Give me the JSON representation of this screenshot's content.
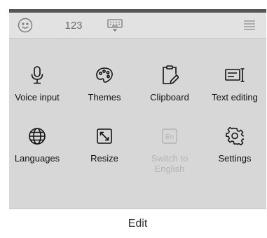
{
  "toolbar": {
    "emoji_icon": "emoji-icon",
    "number_label": "123",
    "keyboard_icon": "keyboard-hide-icon",
    "menu_icon": "menu-icon"
  },
  "options": [
    {
      "label": "Voice input",
      "icon": "microphone-icon",
      "enabled": true
    },
    {
      "label": "Themes",
      "icon": "palette-icon",
      "enabled": true
    },
    {
      "label": "Clipboard",
      "icon": "clipboard-icon",
      "enabled": true
    },
    {
      "label": "Text editing",
      "icon": "text-editing-icon",
      "enabled": true
    },
    {
      "label": "Languages",
      "icon": "globe-icon",
      "enabled": true
    },
    {
      "label": "Resize",
      "icon": "resize-icon",
      "enabled": true
    },
    {
      "label": "Switch to English",
      "line1": "Switch to",
      "line2": "English",
      "icon": "en-language-icon",
      "icon_text": "En",
      "enabled": false
    },
    {
      "label": "Settings",
      "icon": "gear-icon",
      "enabled": true
    }
  ],
  "edit_bar": {
    "label": "Edit"
  },
  "colors": {
    "panel_background": "#d7d7d7",
    "toolbar_background": "#e2e2e2",
    "disabled_text": "#b3b3b3"
  }
}
